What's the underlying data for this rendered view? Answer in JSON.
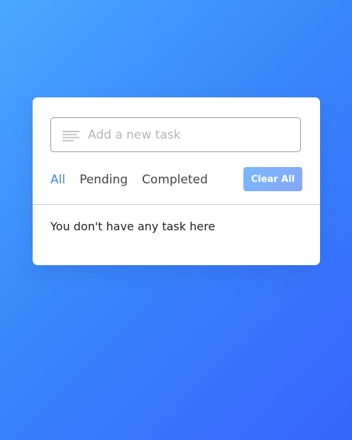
{
  "colors": {
    "background_gradient": [
      "#4aa8ff",
      "#3566fd"
    ],
    "accent": "#3c87ff",
    "clear_button": "#7ab8fb",
    "card": "#ffffff"
  },
  "task_input": {
    "icon": "list-lines-icon",
    "placeholder": "Add a new task",
    "value": ""
  },
  "filters": {
    "items": [
      {
        "label": "All",
        "active": true
      },
      {
        "label": "Pending",
        "active": false
      },
      {
        "label": "Completed",
        "active": false
      }
    ]
  },
  "clear_button": {
    "label": "Clear All"
  },
  "task_list": {
    "empty_message": "You don't have any task here"
  }
}
